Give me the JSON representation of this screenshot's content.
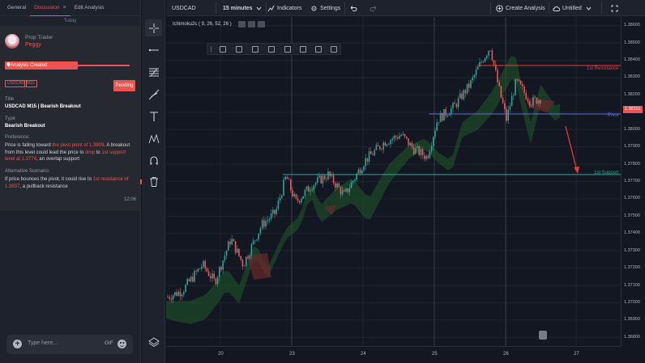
{
  "sidebar": {
    "tabs": [
      {
        "label": "General"
      },
      {
        "label": "Discussion"
      },
      {
        "label": "Edit Analysis"
      }
    ],
    "close_glyph": "×",
    "date_divider": "Today",
    "message": {
      "role": "Prop Trader",
      "author": "Peggy",
      "status_chip": "Analysis Created",
      "tags": [
        "USDCAD",
        "M15"
      ],
      "status": "Pending",
      "title_label": "Title",
      "title_value": "USDCAD M15 | Bearish Breakout",
      "type_label": "Type",
      "type_value": "Bearish Breakout",
      "preference_label": "Preference:",
      "preference_parts": [
        "Price is falling toward ",
        "the pivot point of 1.3809",
        ". A breakout from this level could lead the price to ",
        "drop",
        " to ",
        "1st support level at 1.3774",
        ", an overlap support"
      ],
      "alternative_label": "Alternative Scenario:",
      "alternative_parts": [
        "If price bounces the pivot, it could rise to ",
        "1st resistance of 1.3837",
        ", a pullback resistance"
      ],
      "time": "12:06"
    },
    "composer": {
      "placeholder": "Type here...",
      "gif_label": "GIF"
    }
  },
  "topbar": {
    "symbol": "USDCAD",
    "interval": "15 minutes",
    "indicators": "Indicators",
    "settings": "Settings",
    "create_analysis": "Create Analysis",
    "layout_name": "Untitled"
  },
  "chart": {
    "indicator_label": "Ichimoku2c ( 9, 26, 52, 26 )",
    "price_ticks": [
      "1.38600",
      "1.38500",
      "1.38400",
      "1.38300",
      "1.38200",
      "1.38100",
      "1.38000",
      "1.37900",
      "1.37800",
      "1.37700",
      "1.37600",
      "1.37500",
      "1.37400",
      "1.37300",
      "1.37200",
      "1.37100",
      "1.37000",
      "1.36900",
      "1.36800"
    ],
    "current_price": "1.38151",
    "date_ticks": [
      "20",
      "23",
      "24",
      "25",
      "26",
      "27"
    ],
    "levels": {
      "resistance": {
        "label": "1st Resistance",
        "value": 1.3837,
        "color": "#f23645"
      },
      "pivot": {
        "label": "Pivot",
        "value": 1.3809,
        "color": "#5b6ee1"
      },
      "support": {
        "label": "1st Support",
        "value": 1.3774,
        "color": "#22ab94"
      }
    },
    "colors": {
      "up": "#26a69a",
      "down": "#ef5350",
      "cloud_bull": "#1f5a2a",
      "cloud_bear": "#6b2a2a",
      "arrow": "#e53935"
    }
  },
  "icons": {
    "crosshair": "crosshair-icon",
    "trend": "trend-line-icon",
    "fib": "fib-retracement-icon",
    "brush": "brush-icon",
    "text": "text-icon",
    "pattern": "pattern-icon",
    "magnet": "magnet-icon",
    "trash": "trash-icon",
    "layers": "layers-icon"
  }
}
